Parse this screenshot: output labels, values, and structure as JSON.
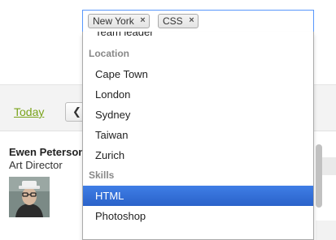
{
  "toolbar": {
    "today_label": "Today"
  },
  "person": {
    "name": "Ewen Peterson",
    "role": "Art Director"
  },
  "select": {
    "tags": [
      {
        "label": "New York"
      },
      {
        "label": "CSS"
      }
    ],
    "remove_symbol": "×",
    "dropdown": {
      "partial_item": "Team leader",
      "groups": [
        {
          "label": "Location",
          "items": [
            "Cape Town",
            "London",
            "Sydney",
            "Taiwan",
            "Zurich"
          ]
        },
        {
          "label": "Skills",
          "items": [
            "HTML",
            "Photoshop"
          ]
        }
      ],
      "highlighted": "HTML"
    }
  },
  "colors": {
    "accent": "#3875d7",
    "link": "#7aa31b"
  },
  "icons": {
    "prev": "chevron-left-icon",
    "remove": "close-icon"
  }
}
